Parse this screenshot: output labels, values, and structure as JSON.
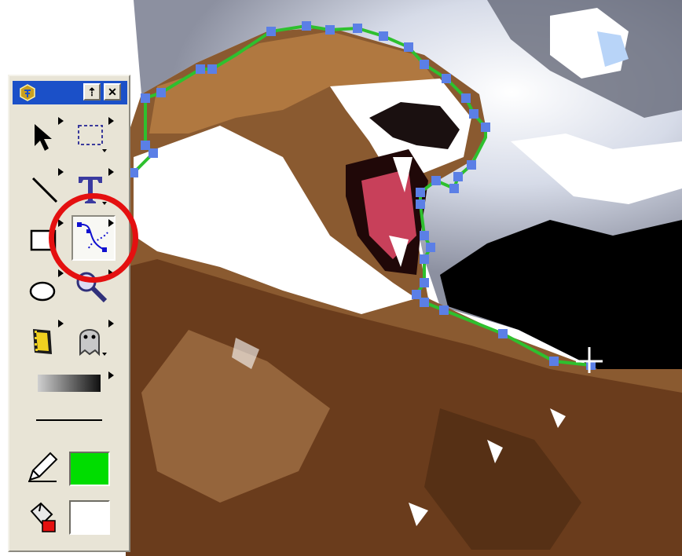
{
  "app": {
    "icon": "fireworks-app-icon",
    "titlebar_color": "#1b50c8",
    "title_buttons": {
      "collapse_glyph": "⇡",
      "close_glyph": "✕"
    }
  },
  "toolbox": {
    "tools": [
      {
        "name": "pointer-tool",
        "icon": "arrow-pointer-icon"
      },
      {
        "name": "marquee-tool",
        "icon": "dashed-rectangle-icon"
      },
      {
        "name": "line-tool",
        "icon": "diagonal-line-icon"
      },
      {
        "name": "text-tool",
        "icon": "text-t-icon",
        "glyph": "T"
      },
      {
        "name": "rectangle-tool",
        "icon": "rectangle-icon"
      },
      {
        "name": "pen-tool",
        "icon": "bezier-pen-icon",
        "selected": true
      },
      {
        "name": "ellipse-tool",
        "icon": "ellipse-icon"
      },
      {
        "name": "magnify-tool",
        "icon": "magnifier-icon"
      },
      {
        "name": "film-strip-tool",
        "icon": "film-strip-icon"
      },
      {
        "name": "ghost-tool",
        "icon": "ghost-icon"
      },
      {
        "name": "gradient-tool",
        "icon": "gradient-fill-icon"
      },
      {
        "name": "stroke-thickness",
        "icon": "stroke-line-icon"
      }
    ],
    "stroke_color": "#00dd00",
    "fill_color": "#ffffff"
  },
  "highlight": {
    "color": "#e41010",
    "target": "pen-tool"
  },
  "path": {
    "stroke_color": "#2ec02e",
    "point_color": "#5b7fe6"
  },
  "cursor": {
    "icon": "crosshair-cursor-icon"
  }
}
